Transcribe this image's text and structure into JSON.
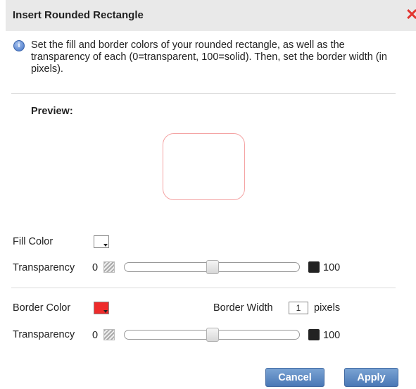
{
  "dialog": {
    "title": "Insert Rounded Rectangle",
    "close_glyph": "✕",
    "info_glyph": "i",
    "description": "Set the fill and border colors of your rounded rectangle, as well as the transparency of each (0=transparent, 100=solid). Then, set the border width (in pixels).",
    "preview_label": "Preview:"
  },
  "fill": {
    "color_label": "Fill Color",
    "color_value": "#ffffff",
    "transparency_label": "Transparency",
    "min": "0",
    "max": "100",
    "slider_value": 0.5
  },
  "border": {
    "color_label": "Border Color",
    "color_value": "#ee2b2b",
    "width_label": "Border Width",
    "width_value": "1",
    "width_unit": "pixels",
    "transparency_label": "Transparency",
    "min": "0",
    "max": "100",
    "slider_value": 0.5
  },
  "buttons": {
    "cancel": "Cancel",
    "apply": "Apply"
  },
  "colors": {
    "button_blue": "#5a87c1",
    "close_red": "#e2342f",
    "preview_border": "#f4a3a3"
  }
}
